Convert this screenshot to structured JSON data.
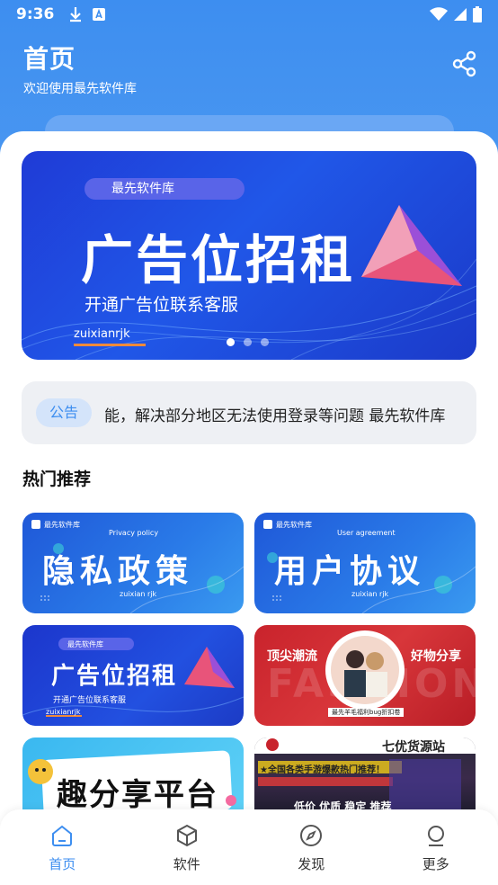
{
  "statusbar": {
    "time": "9:36"
  },
  "header": {
    "title": "首页",
    "subtitle": "欢迎使用最先软件库"
  },
  "banner": {
    "chip": "最先软件库",
    "headline": "广告位招租",
    "subline": "开通广告位联系客服",
    "watermark": "zuixianrjk",
    "dots": 3,
    "active_dot": 0
  },
  "notice": {
    "badge": "公告",
    "text": "能，解决部分地区无法使用登录等问题   最先软件库"
  },
  "section": {
    "title": "热门推荐"
  },
  "cards": [
    {
      "brand": "最先软件库",
      "small": "Privacy policy",
      "title": "隐私政策",
      "footer": "zuixian rjk"
    },
    {
      "brand": "最先软件库",
      "small": "User agreement",
      "title": "用户协议",
      "footer": "zuixian rjk"
    },
    {
      "brand": "最先软件库",
      "title": "广告位招租",
      "sub": "开通广告位联系客服",
      "footer": "zuixianrjk"
    },
    {
      "left": "顶尖潮流",
      "right": "好物分享",
      "bg_text": "FASHION",
      "caption": "最先羊毛福利bug折扣卷"
    },
    {
      "title": "趣分享平台"
    },
    {
      "top": "七优货源站",
      "line1": "★全国各类手游爆款热门推荐！",
      "line2": "低价 优质 稳定 推荐"
    }
  ],
  "tabs": [
    {
      "label": "首页",
      "icon": "home-icon",
      "active": true
    },
    {
      "label": "软件",
      "icon": "cube-icon",
      "active": false
    },
    {
      "label": "发现",
      "icon": "compass-icon",
      "active": false
    },
    {
      "label": "更多",
      "icon": "user-icon",
      "active": false
    }
  ],
  "colors": {
    "primary": "#3d8ef0",
    "banner": "#2057e8",
    "notice_bg": "#eef0f4"
  }
}
